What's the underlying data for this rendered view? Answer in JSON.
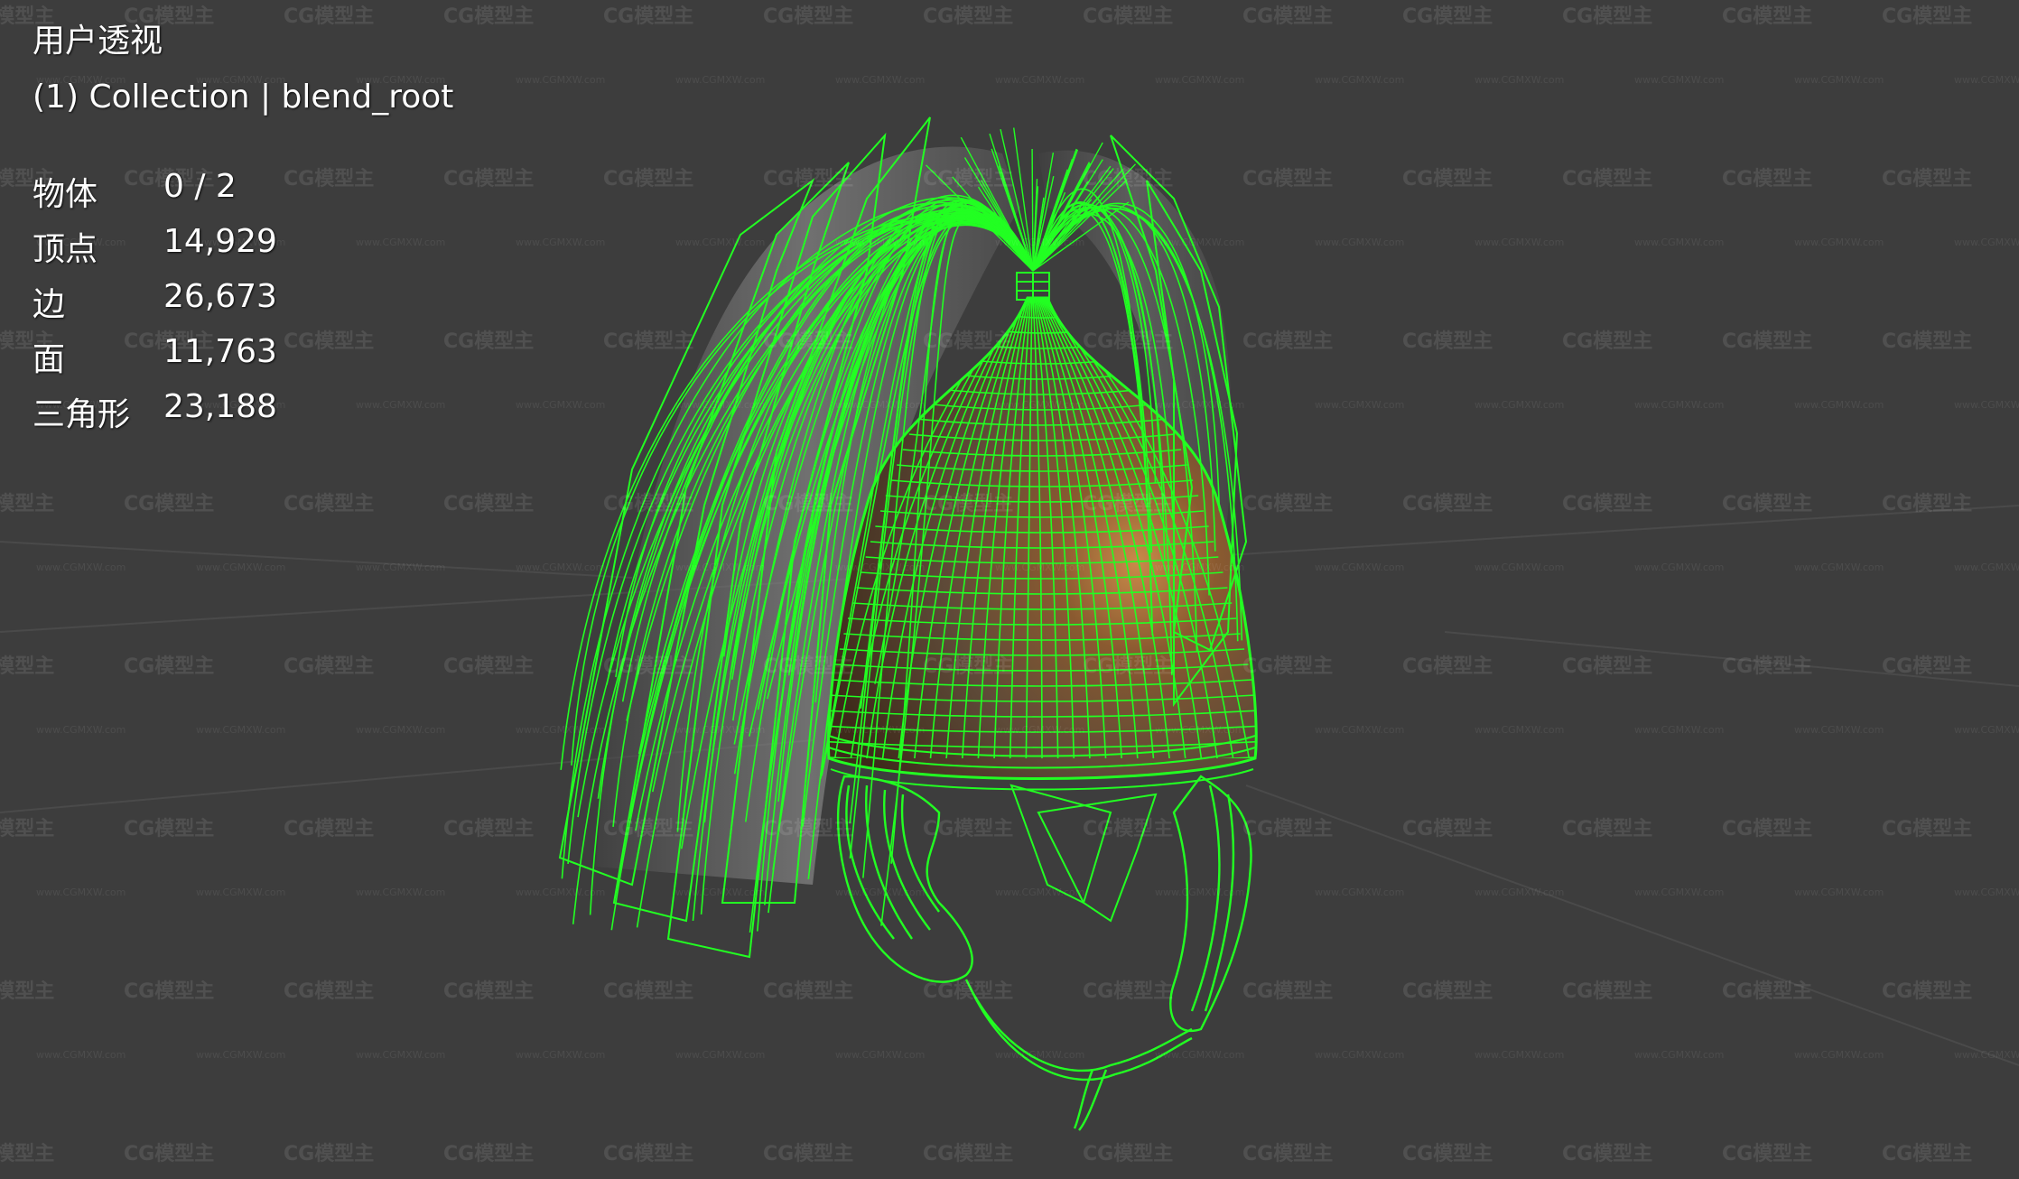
{
  "viewport": {
    "view_name": "用户透视",
    "collection_line": "(1) Collection | blend_root"
  },
  "stats": [
    {
      "label": "物体",
      "value": "0 / 2"
    },
    {
      "label": "顶点",
      "value": "14,929"
    },
    {
      "label": "边",
      "value": "26,673"
    },
    {
      "label": "面",
      "value": "11,763"
    },
    {
      "label": "三角形",
      "value": "23,188"
    }
  ],
  "watermark": {
    "text": "CG模型主",
    "url": "www.CGMXW.com"
  },
  "colors": {
    "background": "#3d3d3d",
    "wireframe": "#22ff22",
    "helmet_bronze": "#7a4a22",
    "hair": "#b8b8b8"
  },
  "icons": {
    "model": "helmet-with-plume-model"
  }
}
